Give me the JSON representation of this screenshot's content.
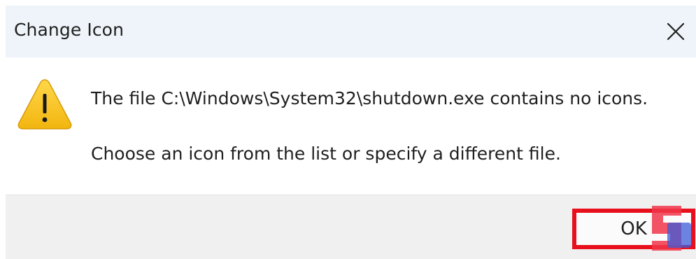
{
  "window": {
    "title": "Change Icon",
    "close_icon": "close-icon"
  },
  "message": {
    "icon": "warning-icon",
    "line1": "The file C:\\Windows\\System32\\shutdown.exe contains no icons.",
    "line2": "Choose an icon from the list or specify a different file."
  },
  "footer": {
    "ok_label": "OK"
  },
  "colors": {
    "title_bar_bg": "#eef4f9",
    "footer_bg": "#f0f0f0",
    "highlight_border": "#e8101c",
    "warning_yellow": "#f6c21a"
  }
}
